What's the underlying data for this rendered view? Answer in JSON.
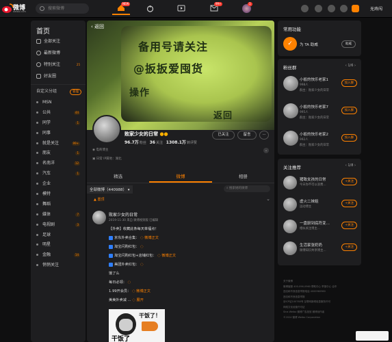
{
  "topbar": {
    "logo_text": "微博",
    "logo_sub": "weibo.com",
    "search_placeholder": "搜索微博",
    "home_badge": "NEW",
    "msg_badge": "99+",
    "user_badge": "1",
    "user_name": "无痔闯"
  },
  "left": {
    "title": "首页",
    "items": [
      {
        "label": "全部关注"
      },
      {
        "label": "最新微博"
      },
      {
        "label": "特别关注",
        "count": "25"
      },
      {
        "label": "好友圈"
      }
    ],
    "custom_title": "自定义分组",
    "manage_label": "管理",
    "groups": [
      {
        "label": "MSN",
        "count": ""
      },
      {
        "label": "公共",
        "count": "44"
      },
      {
        "label": "同学",
        "count": "1"
      },
      {
        "label": "同事",
        "count": ""
      },
      {
        "label": "就是关注",
        "count": "99+"
      },
      {
        "label": "朋友",
        "count": "1"
      },
      {
        "label": "名南洋",
        "count": "12"
      },
      {
        "label": "汽车",
        "count": "1"
      },
      {
        "label": "企业",
        "count": ""
      },
      {
        "label": "模特",
        "count": ""
      },
      {
        "label": "舞蹈",
        "count": ""
      },
      {
        "label": "媒体",
        "count": "7"
      },
      {
        "label": "电视剧",
        "count": "3"
      },
      {
        "label": "足球",
        "count": ""
      },
      {
        "label": "明星",
        "count": ""
      },
      {
        "label": "金融",
        "count": "14"
      },
      {
        "label": "悄悄关注",
        "count": ""
      }
    ]
  },
  "profile": {
    "back_label": "返回",
    "cover_line1": "备用号请关注",
    "cover_line2": "@扳扳爱囤货",
    "cover_line3": "操作",
    "cover_line4": "返回",
    "name": "败家少女的日常",
    "fans_num": "96.7万",
    "fans_label": "粉丝",
    "follow_num": "36",
    "follow_label": "关注",
    "likes_num": "1308.1万",
    "likes_label": "转评赞",
    "followed_label": "已关注",
    "message_label": "留言",
    "more_label": "···",
    "bio": "电商博主",
    "info_line": "日常  IP属地：湖北",
    "tabs": [
      "精选",
      "微博",
      "相册"
    ],
    "filter_label": "全部微博（440988）",
    "search_label": "搜索她的微博"
  },
  "post": {
    "pinned": "置顶",
    "author": "败家少女的日常",
    "time": "2019-11-30 来自 微博视频版 已编辑",
    "lines": [
      {
        "text": "【外卖】收藏此条每天单福点！"
      },
      {
        "text": "京东外卖合集：",
        "link": "微博正文"
      },
      {
        "text": "淘宝闪购红包：",
        "link": ""
      },
      {
        "text": "淘宝闪购红包+店铺红包：",
        "link": "微博正文"
      },
      {
        "text": "美团外卖红包：",
        "link": ""
      },
      {
        "text": "饿了么"
      },
      {
        "text": "每日必领：",
        "link": ""
      },
      {
        "text": "1.99开会员：",
        "link": "微博正文"
      },
      {
        "text": "美美外卖减 ... ",
        "link": "展开"
      }
    ],
    "meme_top": "干饭了！",
    "meme_bottom": "干饭了"
  },
  "right": {
    "common_title": "常用功能",
    "common_item": "为 TA 助威",
    "common_btn": "助威",
    "fans_title": "粉丝群",
    "fans_page": "1/6",
    "fans_groups": [
      {
        "name": "小扳的快乐老家1",
        "members": "998人",
        "owner": "群主：败家少女的日常",
        "btn": "加入群"
      },
      {
        "name": "小扳的快乐老家7",
        "members": "995人",
        "owner": "群主：败家少女的日常",
        "btn": "加入群"
      },
      {
        "name": "小扳的快乐老家2",
        "members": "992人",
        "owner": "群主：败家少女的日常",
        "btn": "加入群"
      }
    ],
    "rec_title": "关注推荐",
    "rec_page": "1/8",
    "recs": [
      {
        "name": "猪致女孩的日常",
        "desc": "今天你不可以浪费…",
        "btn": "+关注"
      },
      {
        "name": "虚火二妹姐",
        "desc": "运动博主",
        "btn": "+关注"
      },
      {
        "name": "一盘厨到底符变…",
        "desc": "相似关注博主…",
        "btn": "+关注"
      },
      {
        "name": "生活家张奶奶",
        "desc": "微博知识共享博主…",
        "btn": "+关注"
      }
    ],
    "footer_lines": [
      "关于微博",
      "微博客服 400-096-0960   帮助中心   举报中心   合作",
      "违法和不良信息举报电话 4000960960",
      "违法和不良信息举报",
      "京ICP证100780号   互联网新闻信息服务许可",
      "网络文化经营许可证",
      "Sina Weibo   微博广告投放   微博创作者",
      "©2024 微博 Weibo Corporation"
    ]
  }
}
